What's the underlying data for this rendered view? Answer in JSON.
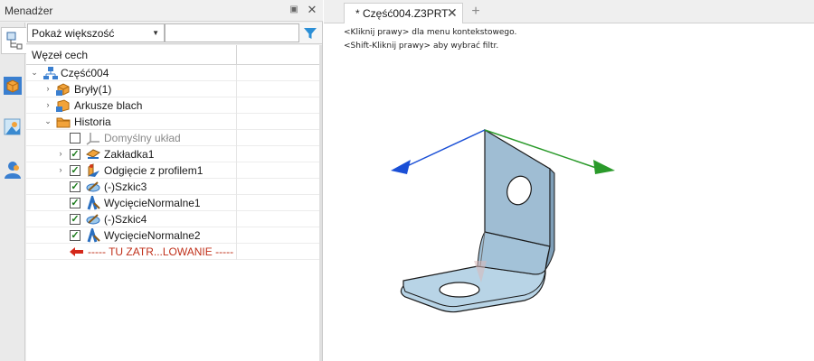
{
  "manager": {
    "title": "Menadżer",
    "filter": {
      "selected": "Pokaż większość",
      "input_value": ""
    },
    "tree_column_header": "Węzeł cech",
    "side_tabs": [
      "history-tree-icon",
      "part-cube-icon",
      "assembly-icon",
      "user-icon"
    ],
    "tree": {
      "root": "Część004",
      "items": [
        {
          "label": "Bryły(1)",
          "icon": "solid-body-icon"
        },
        {
          "label": "Arkusze blach",
          "icon": "sheet-metal-icon"
        },
        {
          "label": "Historia",
          "icon": "folder-icon"
        },
        {
          "label": "Domyślny układ",
          "icon": "csys-icon",
          "checked": false
        },
        {
          "label": "Zakładka1",
          "icon": "tab-feature-icon",
          "checked": true
        },
        {
          "label": "Odgięcie z profilem1",
          "icon": "flange-icon",
          "checked": true
        },
        {
          "label": "(-)Szkic3",
          "icon": "sketch-icon",
          "checked": true
        },
        {
          "label": "WycięcieNormalne1",
          "icon": "normal-cut-icon",
          "checked": true
        },
        {
          "label": "(-)Szkic4",
          "icon": "sketch-icon",
          "checked": true
        },
        {
          "label": "WycięcieNormalne2",
          "icon": "normal-cut-icon",
          "checked": true
        },
        {
          "label": "----- TU ZATR...LOWANIE -----",
          "icon": "rollback-arrow-icon"
        }
      ]
    }
  },
  "document": {
    "tab_label": "* Część004.Z3PRT",
    "hints": [
      "<Kliknij prawy> dla menu kontekstowego.",
      "<Shift-Kliknij prawy> aby wybrać filtr."
    ]
  },
  "colors": {
    "part_fill": "#9fc0d6",
    "axis_x": "#2a9a2a",
    "axis_blue": "#1a4fd6",
    "rollback_red": "#c0301a"
  }
}
